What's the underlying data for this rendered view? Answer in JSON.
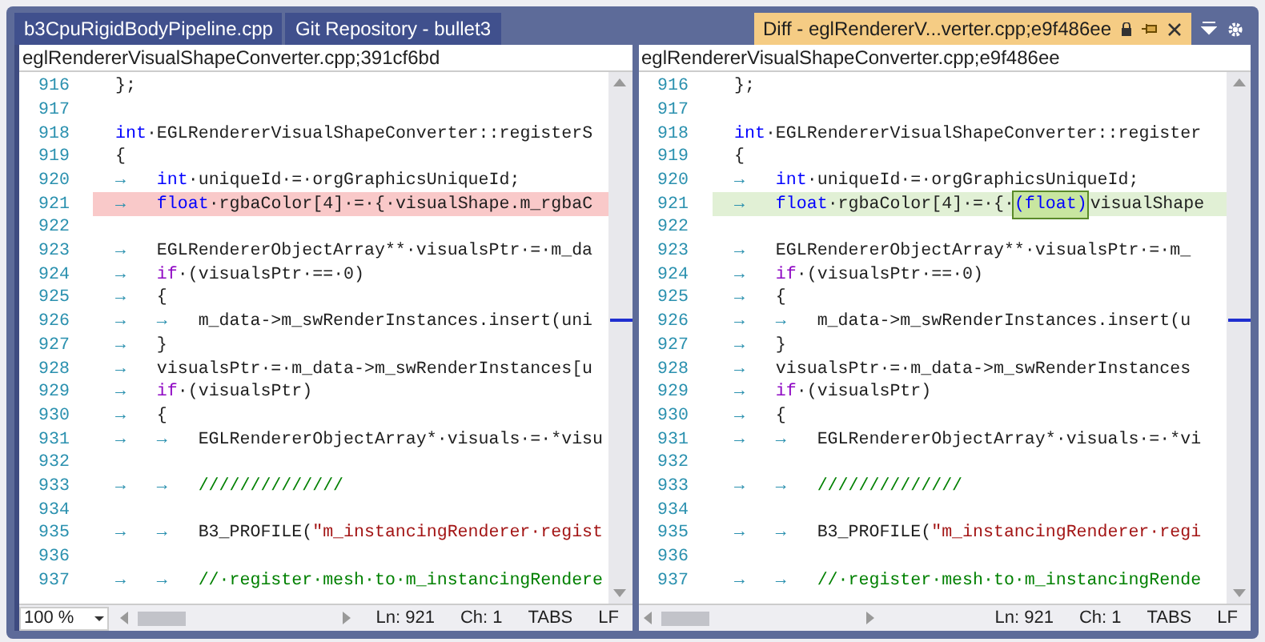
{
  "tabs": [
    {
      "label": "b3CpuRigidBodyPipeline.cpp",
      "selected": false,
      "kind": "document"
    },
    {
      "label": "Git Repository - bullet3",
      "selected": false,
      "kind": "document"
    },
    {
      "label": "Diff - eglRendererV...verter.cpp;e9f486ee",
      "selected": true,
      "kind": "diff"
    }
  ],
  "panes": [
    {
      "file": "eglRendererVisualShapeConverter.cpp;391cf6bd",
      "zoom": "100 %",
      "status": [
        "Ln: 921",
        "Ch: 1",
        "TABS",
        "LF"
      ],
      "lines": [
        {
          "number": "916",
          "tokens": [
            {
              "kind": "plain",
              "text": "};"
            }
          ]
        },
        {
          "number": "917"
        },
        {
          "number": "918",
          "tokens": [
            {
              "kind": "keyword",
              "text": "int"
            },
            {
              "kind": "plain",
              "text": "·EGLRendererVisualShapeConverter::registerS"
            }
          ]
        },
        {
          "number": "919",
          "tokens": [
            {
              "kind": "plain",
              "text": "{"
            }
          ]
        },
        {
          "number": "920",
          "tokens": [
            {
              "kind": "tab",
              "text": "→"
            },
            {
              "kind": "keyword",
              "text": "int"
            },
            {
              "kind": "plain",
              "text": "·uniqueId·=·orgGraphicsUniqueId;"
            }
          ]
        },
        {
          "number": "921",
          "removed": true,
          "tokens": [
            {
              "kind": "tab",
              "text": "→"
            },
            {
              "kind": "keyword",
              "text": "float"
            },
            {
              "kind": "plain",
              "text": "·rgbaColor[4]·=·{·visualShape.m_rgbaC"
            }
          ]
        },
        {
          "number": "922"
        },
        {
          "number": "923",
          "tokens": [
            {
              "kind": "tab",
              "text": "→"
            },
            {
              "kind": "plain",
              "text": "EGLRendererObjectArray**·visualsPtr·=·m_da"
            }
          ]
        },
        {
          "number": "924",
          "tokens": [
            {
              "kind": "tab",
              "text": "→"
            },
            {
              "kind": "control",
              "text": "if"
            },
            {
              "kind": "plain",
              "text": "·(visualsPtr·==·0)"
            }
          ]
        },
        {
          "number": "925",
          "tokens": [
            {
              "kind": "tab",
              "text": "→"
            },
            {
              "kind": "plain",
              "text": "{"
            }
          ]
        },
        {
          "number": "926",
          "tokens": [
            {
              "kind": "tab",
              "text": "→"
            },
            {
              "kind": "tab",
              "text": "→"
            },
            {
              "kind": "plain",
              "text": "m_data->m_swRenderInstances.insert(uni"
            }
          ]
        },
        {
          "number": "927",
          "tokens": [
            {
              "kind": "tab",
              "text": "→"
            },
            {
              "kind": "plain",
              "text": "}"
            }
          ]
        },
        {
          "number": "928",
          "tokens": [
            {
              "kind": "tab",
              "text": "→"
            },
            {
              "kind": "plain",
              "text": "visualsPtr·=·m_data->m_swRenderInstances[u"
            }
          ]
        },
        {
          "number": "929",
          "tokens": [
            {
              "kind": "tab",
              "text": "→"
            },
            {
              "kind": "control",
              "text": "if"
            },
            {
              "kind": "plain",
              "text": "·(visualsPtr)"
            }
          ]
        },
        {
          "number": "930",
          "tokens": [
            {
              "kind": "tab",
              "text": "→"
            },
            {
              "kind": "plain",
              "text": "{"
            }
          ]
        },
        {
          "number": "931",
          "tokens": [
            {
              "kind": "tab",
              "text": "→"
            },
            {
              "kind": "tab",
              "text": "→"
            },
            {
              "kind": "plain",
              "text": "EGLRendererObjectArray*·visuals·=·*visu"
            }
          ]
        },
        {
          "number": "932"
        },
        {
          "number": "933",
          "tokens": [
            {
              "kind": "tab",
              "text": "→"
            },
            {
              "kind": "tab",
              "text": "→"
            },
            {
              "kind": "comment",
              "text": "//////////////"
            }
          ]
        },
        {
          "number": "934"
        },
        {
          "number": "935",
          "tokens": [
            {
              "kind": "tab",
              "text": "→"
            },
            {
              "kind": "tab",
              "text": "→"
            },
            {
              "kind": "plain",
              "text": "B3_PROFILE("
            },
            {
              "kind": "string",
              "text": "\"m_instancingRenderer·regist"
            }
          ]
        },
        {
          "number": "936"
        },
        {
          "number": "937",
          "tokens": [
            {
              "kind": "tab",
              "text": "→"
            },
            {
              "kind": "tab",
              "text": "→"
            },
            {
              "kind": "comment",
              "text": "//·register·mesh·to·m_instancingRendere"
            }
          ]
        }
      ]
    },
    {
      "file": "eglRendererVisualShapeConverter.cpp;e9f486ee",
      "status": [
        "Ln: 921",
        "Ch: 1",
        "TABS",
        "LF"
      ],
      "lines": [
        {
          "number": "916",
          "tokens": [
            {
              "kind": "plain",
              "text": "};"
            }
          ]
        },
        {
          "number": "917"
        },
        {
          "number": "918",
          "tokens": [
            {
              "kind": "keyword",
              "text": "int"
            },
            {
              "kind": "plain",
              "text": "·EGLRendererVisualShapeConverter::register"
            }
          ]
        },
        {
          "number": "919",
          "tokens": [
            {
              "kind": "plain",
              "text": "{"
            }
          ]
        },
        {
          "number": "920",
          "tokens": [
            {
              "kind": "tab",
              "text": "→"
            },
            {
              "kind": "keyword",
              "text": "int"
            },
            {
              "kind": "plain",
              "text": "·uniqueId·=·orgGraphicsUniqueId;"
            }
          ]
        },
        {
          "number": "921",
          "added": true,
          "tokens": [
            {
              "kind": "tab",
              "text": "→"
            },
            {
              "kind": "keyword",
              "text": "float"
            },
            {
              "kind": "plain",
              "text": "·rgbaColor[4]·=·{·"
            },
            {
              "kind": "inserted",
              "text": "(float)"
            },
            {
              "kind": "plain",
              "text": "visualShape"
            }
          ]
        },
        {
          "number": "922"
        },
        {
          "number": "923",
          "tokens": [
            {
              "kind": "tab",
              "text": "→"
            },
            {
              "kind": "plain",
              "text": "EGLRendererObjectArray**·visualsPtr·=·m_"
            }
          ]
        },
        {
          "number": "924",
          "tokens": [
            {
              "kind": "tab",
              "text": "→"
            },
            {
              "kind": "control",
              "text": "if"
            },
            {
              "kind": "plain",
              "text": "·(visualsPtr·==·0)"
            }
          ]
        },
        {
          "number": "925",
          "tokens": [
            {
              "kind": "tab",
              "text": "→"
            },
            {
              "kind": "plain",
              "text": "{"
            }
          ]
        },
        {
          "number": "926",
          "tokens": [
            {
              "kind": "tab",
              "text": "→"
            },
            {
              "kind": "tab",
              "text": "→"
            },
            {
              "kind": "plain",
              "text": "m_data->m_swRenderInstances.insert(u"
            }
          ]
        },
        {
          "number": "927",
          "tokens": [
            {
              "kind": "tab",
              "text": "→"
            },
            {
              "kind": "plain",
              "text": "}"
            }
          ]
        },
        {
          "number": "928",
          "tokens": [
            {
              "kind": "tab",
              "text": "→"
            },
            {
              "kind": "plain",
              "text": "visualsPtr·=·m_data->m_swRenderInstances"
            }
          ]
        },
        {
          "number": "929",
          "tokens": [
            {
              "kind": "tab",
              "text": "→"
            },
            {
              "kind": "control",
              "text": "if"
            },
            {
              "kind": "plain",
              "text": "·(visualsPtr)"
            }
          ]
        },
        {
          "number": "930",
          "tokens": [
            {
              "kind": "tab",
              "text": "→"
            },
            {
              "kind": "plain",
              "text": "{"
            }
          ]
        },
        {
          "number": "931",
          "tokens": [
            {
              "kind": "tab",
              "text": "→"
            },
            {
              "kind": "tab",
              "text": "→"
            },
            {
              "kind": "plain",
              "text": "EGLRendererObjectArray*·visuals·=·*vi"
            }
          ]
        },
        {
          "number": "932"
        },
        {
          "number": "933",
          "tokens": [
            {
              "kind": "tab",
              "text": "→"
            },
            {
              "kind": "tab",
              "text": "→"
            },
            {
              "kind": "comment",
              "text": "//////////////"
            }
          ]
        },
        {
          "number": "934"
        },
        {
          "number": "935",
          "tokens": [
            {
              "kind": "tab",
              "text": "→"
            },
            {
              "kind": "tab",
              "text": "→"
            },
            {
              "kind": "plain",
              "text": "B3_PROFILE("
            },
            {
              "kind": "string",
              "text": "\"m_instancingRenderer·regi"
            }
          ]
        },
        {
          "number": "936"
        },
        {
          "number": "937",
          "tokens": [
            {
              "kind": "tab",
              "text": "→"
            },
            {
              "kind": "tab",
              "text": "→"
            },
            {
              "kind": "comment",
              "text": "//·register·mesh·to·m_instancingRende"
            }
          ]
        }
      ]
    }
  ]
}
